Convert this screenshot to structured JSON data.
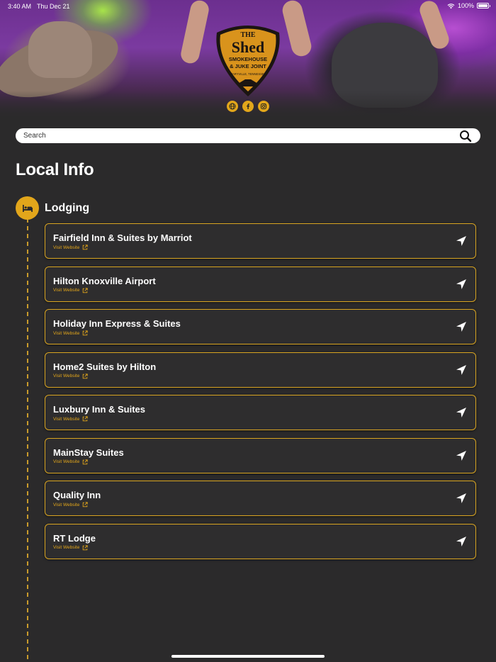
{
  "status_bar": {
    "time": "3:40 AM",
    "date": "Thu Dec 21",
    "battery": "100%"
  },
  "brand": {
    "logo_text_top": "THE",
    "logo_text_main": "Shed",
    "logo_text_sub1": "SMOKEHOUSE",
    "logo_text_sub2": "& JUKE JOINT",
    "logo_text_location": "MARYVILLE, TENNESSEE",
    "accent_color": "#e2a61b"
  },
  "social": {
    "icons": [
      "globe-icon",
      "facebook-icon",
      "instagram-icon"
    ]
  },
  "search": {
    "placeholder": "Search"
  },
  "page": {
    "title": "Local Info"
  },
  "category": {
    "label": "Lodging",
    "icon": "bed-icon"
  },
  "listings": [
    {
      "name": "Fairfield Inn & Suites by Marriot",
      "link_label": "Visit Website"
    },
    {
      "name": "Hilton Knoxville Airport",
      "link_label": "Visit Website"
    },
    {
      "name": "Holiday Inn Express & Suites",
      "link_label": "Visit Website"
    },
    {
      "name": "Home2 Suites by Hilton",
      "link_label": "Visit Website"
    },
    {
      "name": "Luxbury Inn & Suites",
      "link_label": "Visit Website"
    },
    {
      "name": "MainStay Suites",
      "link_label": "Visit Website"
    },
    {
      "name": "Quality Inn",
      "link_label": "Visit Website"
    },
    {
      "name": "RT Lodge",
      "link_label": "Visit Website"
    }
  ]
}
